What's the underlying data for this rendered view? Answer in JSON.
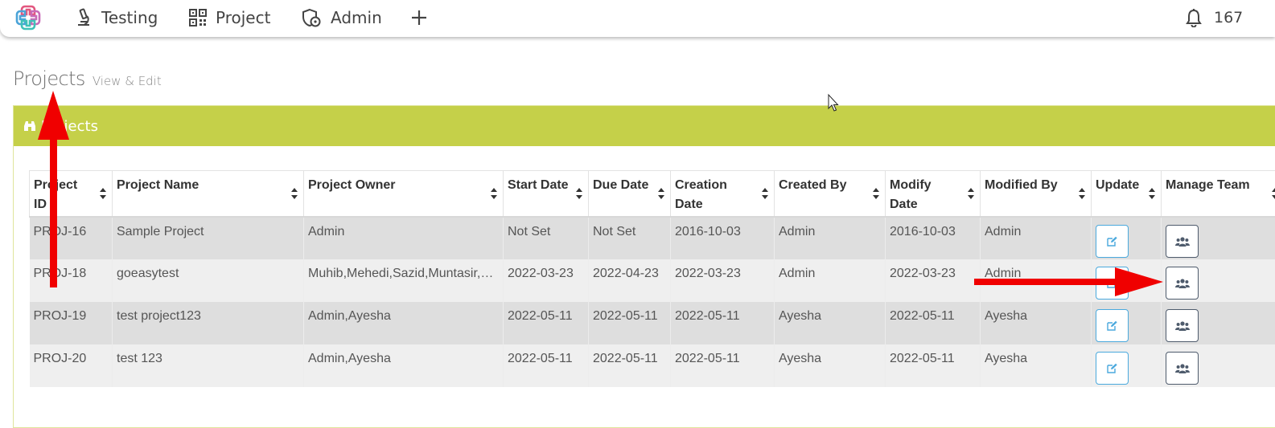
{
  "nav": {
    "items": [
      {
        "label": "Testing",
        "icon": "microscope-icon"
      },
      {
        "label": "Project",
        "icon": "qr-grid-icon"
      },
      {
        "label": "Admin",
        "icon": "admin-shield-icon"
      }
    ],
    "add_icon": "plus-icon",
    "notifications": {
      "icon": "bell-icon",
      "count": "167"
    }
  },
  "page": {
    "title": "Projects",
    "subtitle": "View & Edit"
  },
  "panel": {
    "title": "Projects",
    "icon": "binoculars-icon",
    "accent_color": "#c5d049"
  },
  "table": {
    "columns": [
      "Project ID",
      "Project Name",
      "Project Owner",
      "Start Date",
      "Due Date",
      "Creation Date",
      "Created By",
      "Modify Date",
      "Modified By",
      "Update",
      "Manage Team"
    ],
    "rows": [
      {
        "id": "PROJ-16",
        "name": "Sample Project",
        "owner": "Admin",
        "start": "Not Set",
        "due": "Not Set",
        "created": "2016-10-03",
        "created_by": "Admin",
        "modified": "2016-10-03",
        "modified_by": "Admin"
      },
      {
        "id": "PROJ-18",
        "name": "goeasytest",
        "owner": "Muhib,Mehedi,Sazid,Muntasir,Ayesha",
        "start": "2022-03-23",
        "due": "2022-04-23",
        "created": "2022-03-23",
        "created_by": "Admin",
        "modified": "2022-03-23",
        "modified_by": "Admin"
      },
      {
        "id": "PROJ-19",
        "name": "test project123",
        "owner": "Admin,Ayesha",
        "start": "2022-05-11",
        "due": "2022-05-11",
        "created": "2022-05-11",
        "created_by": "Ayesha",
        "modified": "2022-05-11",
        "modified_by": "Ayesha"
      },
      {
        "id": "PROJ-20",
        "name": "test 123",
        "owner": "Admin,Ayesha",
        "start": "2022-05-11",
        "due": "2022-05-11",
        "created": "2022-05-11",
        "created_by": "Ayesha",
        "modified": "2022-05-11",
        "modified_by": "Ayesha"
      }
    ],
    "update_icon": "edit-icon",
    "team_icon": "users-icon"
  },
  "annotations": {
    "arrow_color": "#f00000"
  }
}
